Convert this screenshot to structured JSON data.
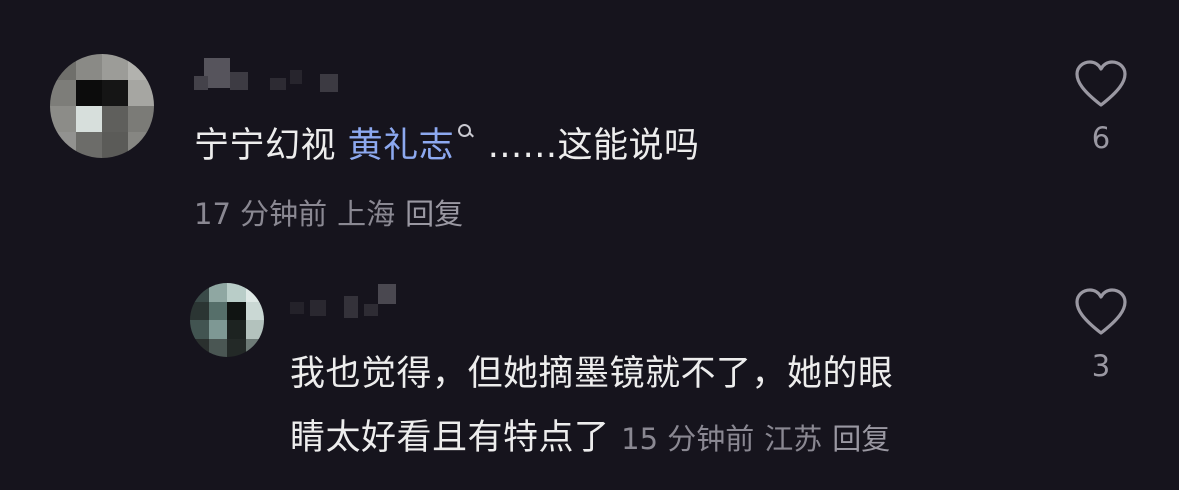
{
  "comments": [
    {
      "mention": "黄礼志",
      "prefix": "宁宁幻视 ",
      "suffix": " ......这能说吗",
      "time": "17 分钟前",
      "location": "上海",
      "reply_label": "回复",
      "likes": "6"
    },
    {
      "line1": "我也觉得，但她摘墨镜就不了，她的眼",
      "line2": "睛太好看且有特点了",
      "time": "15 分钟前",
      "location": "江苏",
      "reply_label": "回复",
      "likes": "3"
    }
  ],
  "icons": {
    "like": "heart-outline-icon",
    "mention_search": "search-icon"
  },
  "colors": {
    "background": "#16141d",
    "text": "#ededed",
    "mention": "#8da9f0",
    "meta": "#8a8892"
  }
}
